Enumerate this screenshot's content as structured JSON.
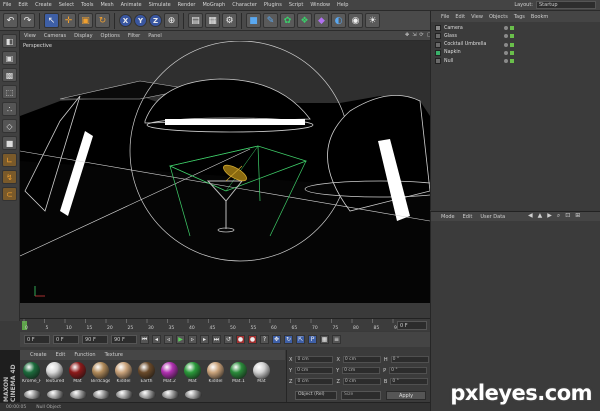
{
  "app": {
    "menu": [
      "File",
      "Edit",
      "Create",
      "Select",
      "Tools",
      "Mesh",
      "Animate",
      "Simulate",
      "Render",
      "MoGraph",
      "Character",
      "Plugins",
      "Script",
      "Window",
      "Help"
    ],
    "layout_label": "Layout:",
    "layout_value": "Startup"
  },
  "toolbar": {
    "axis_x": "X",
    "axis_y": "Y",
    "axis_z": "Z"
  },
  "viewport": {
    "menu": [
      "View",
      "Cameras",
      "Display",
      "Options",
      "Filter",
      "Panel"
    ],
    "label": "Perspective"
  },
  "timeline": {
    "ticks": [
      "0",
      "5",
      "10",
      "15",
      "20",
      "25",
      "30",
      "35",
      "40",
      "45",
      "50",
      "55",
      "60",
      "65",
      "70",
      "75",
      "80",
      "85",
      "90"
    ],
    "end_field": "0 F",
    "start_frame": "0 F",
    "current_frame": "0 F",
    "end_frame_a": "90 F",
    "end_frame_b": "90 F"
  },
  "materials": {
    "menu": [
      "Create",
      "Edit",
      "Function",
      "Texture"
    ],
    "brand": "MAXON CINEMA 4D",
    "items": [
      {
        "label": "Krome_F",
        "color": "#1c6b3c"
      },
      {
        "label": "Textured",
        "color": "#d8d8d8"
      },
      {
        "label": "Mat",
        "color": "#8c1a1a"
      },
      {
        "label": "Birdcage",
        "color": "#b08a5a"
      },
      {
        "label": "Kiddel",
        "color": "#c9a27a"
      },
      {
        "label": "Earth",
        "color": "#6a4a2a"
      },
      {
        "label": "Mat.2",
        "color": "#b030b0"
      },
      {
        "label": "Mat",
        "color": "#2a9a3a"
      },
      {
        "label": "Kiddel",
        "color": "#c9a27a"
      },
      {
        "label": "Mat.1",
        "color": "#2a8a3a"
      },
      {
        "label": "Mat",
        "color": "#cfcfcf"
      }
    ]
  },
  "coords": {
    "rows": [
      {
        "axis": "X",
        "pos": "0 cm",
        "size": "0 cm",
        "rot_axis": "H",
        "rot": "0 °"
      },
      {
        "axis": "Y",
        "pos": "0 cm",
        "size": "0 cm",
        "rot_axis": "P",
        "rot": "0 °"
      },
      {
        "axis": "Z",
        "pos": "0 cm",
        "size": "0 cm",
        "rot_axis": "B",
        "rot": "0 °"
      }
    ],
    "mode_select": "Object (Rel)",
    "size_select": "Size",
    "apply": "Apply"
  },
  "status": {
    "time": "00:00:05",
    "message": "Null Object"
  },
  "objects": {
    "menu": [
      "File",
      "Edit",
      "View",
      "Objects",
      "Tags",
      "Bookm"
    ],
    "items": [
      {
        "name": "Camera"
      },
      {
        "name": "Glass"
      },
      {
        "name": "Cocktail Umbrella"
      },
      {
        "name": "Napkin"
      },
      {
        "name": "Null"
      }
    ]
  },
  "attributes": {
    "menu": [
      "Mode",
      "Edit",
      "User Data"
    ]
  },
  "watermark": "pxleyes.com"
}
